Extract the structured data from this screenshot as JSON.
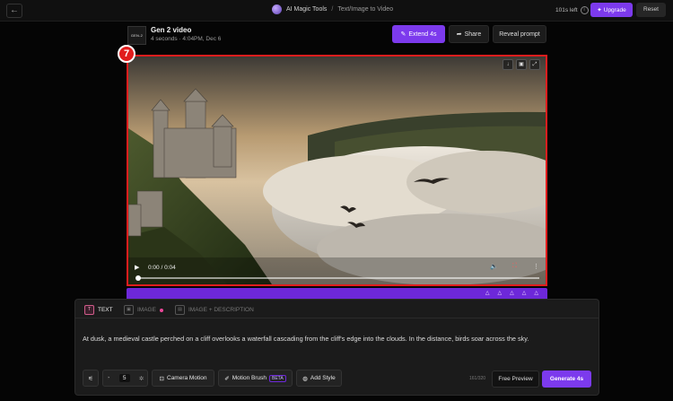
{
  "topbar": {
    "back_icon": "arrow-left-icon",
    "app_name": "AI Magic Tools",
    "breadcrumb_sep": "/",
    "page_name": "Text/Image to Video",
    "credits": "101s left",
    "upgrade_label": "Upgrade",
    "reset_label": "Reset"
  },
  "generation": {
    "thumb_label": "GEN-2",
    "title": "Gen 2 video",
    "meta": "4 seconds · 4:04PM, Dec 6",
    "extend_label": "Extend 4s",
    "share_label": "Share",
    "reveal_label": "Reveal prompt"
  },
  "badge": {
    "number": "7"
  },
  "video": {
    "time": "0:00 / 0:04",
    "progress": 0,
    "tool_icons": [
      "download-icon",
      "pin-icon",
      "expand-icon"
    ]
  },
  "prompt": {
    "tabs": [
      {
        "label": "TEXT",
        "active": true
      },
      {
        "label": "IMAGE",
        "active": false
      },
      {
        "label": "IMAGE + DESCRIPTION",
        "active": false
      }
    ],
    "text": "At dusk, a medieval castle perched on a cliff overlooks a waterfall cascading from the cliff's edge into the clouds. In the distance, birds soar across the sky.",
    "seed_value": "5",
    "camera_motion_label": "Camera Motion",
    "motion_brush_label": "Motion Brush",
    "beta_label": "BETA",
    "add_style_label": "Add Style",
    "char_count": "161/320",
    "preview_label": "Free Preview",
    "generate_label": "Generate 4s"
  },
  "colors": {
    "accent": "#7c3aed",
    "highlight": "#e11d1d"
  }
}
